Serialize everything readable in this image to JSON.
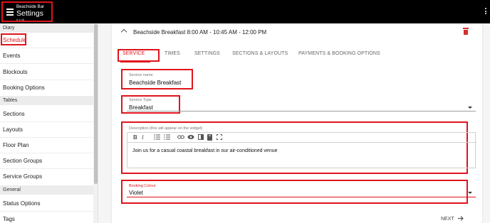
{
  "topbar": {
    "venue": "Beachside Bar",
    "title": "Settings",
    "version": "6.4.46",
    "menu_icon": "hamburger-menu-icon",
    "more_icon": "more-vertical-icon"
  },
  "sidebar": {
    "sections": [
      {
        "label": "Diary"
      },
      {
        "label": "Tables"
      },
      {
        "label": "General"
      }
    ],
    "items": [
      {
        "label": "Schedule",
        "active": true
      },
      {
        "label": "Events"
      },
      {
        "label": "Blockouts"
      },
      {
        "label": "Booking Options"
      },
      {
        "label": "Sections"
      },
      {
        "label": "Layouts"
      },
      {
        "label": "Floor Plan"
      },
      {
        "label": "Section Groups"
      },
      {
        "label": "Service Groups"
      },
      {
        "label": "Status Options"
      },
      {
        "label": "Tags"
      }
    ]
  },
  "service": {
    "header_title": "Beachside Breakfast 8:00 AM - 10:45 AM - 12:00 PM",
    "tabs": [
      {
        "label": "SERVICE",
        "active": true
      },
      {
        "label": "TIMES"
      },
      {
        "label": "SETTINGS"
      },
      {
        "label": "SECTIONS & LAYOUTS"
      },
      {
        "label": "PAYMENTS & BOOKING OPTIONS"
      }
    ],
    "service_name": {
      "label": "Service name",
      "value": "Beachside Breakfast"
    },
    "service_type": {
      "label": "Service Type",
      "value": "Breakfast"
    },
    "description": {
      "label": "Description (this will appear on the widget)",
      "value": "Join us for a casual coastal breakfast in our air-conditioned venue",
      "toolbar": [
        "bold-icon",
        "italic-icon",
        "bulleted-list-icon",
        "numbered-list-icon",
        "link-icon",
        "preview-eye-icon",
        "side-by-side-icon",
        "guide-book-icon",
        "fullscreen-icon"
      ]
    },
    "booking_colour": {
      "label": "Booking Colour",
      "value": "Violet"
    },
    "next_label": "NEXT"
  },
  "colors": {
    "accent": "#e0141b",
    "delete": "#d32f2f",
    "topbar": "#000000"
  }
}
